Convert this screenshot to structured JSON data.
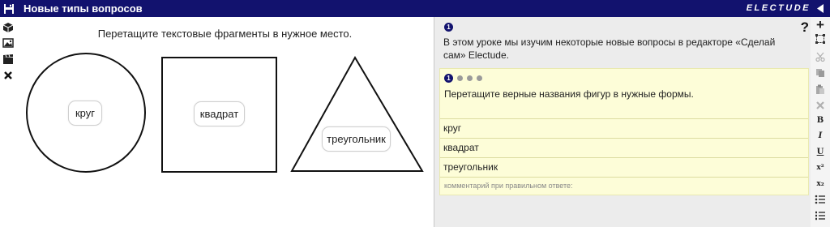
{
  "header": {
    "title": "Новые типы вопросов",
    "brand": "ELECTUDE",
    "save_icon": "floppy-disk-icon",
    "collapse_icon": "caret-left-icon"
  },
  "left_toolbar": {
    "icons": [
      "cube-icon",
      "image-icon",
      "video-clapper-icon",
      "close-icon"
    ]
  },
  "canvas": {
    "instruction": "Перетащите текстовые фрагменты в нужное место.",
    "labels": {
      "circle": "круг",
      "square": "квадрат",
      "triangle": "треугольник"
    }
  },
  "editor": {
    "intro_badge": "1",
    "help_label": "?",
    "intro_text": "В этом уроке мы изучим некоторые новые вопросы в редакторе «Сделай сам» Electude.",
    "question": {
      "badge": "1",
      "text": "Перетащите верные названия фигур в нужные формы.",
      "answers": [
        "круг",
        "квадрат",
        "треугольник"
      ],
      "comment_placeholder": "комментарий при правильном ответе:"
    }
  },
  "right_toolbar": {
    "add_label": "+",
    "bold_label": "B",
    "italic_label": "I",
    "underline_label": "U",
    "superscript_label": "x²",
    "subscript_label": "x₂",
    "icons": [
      "add-icon",
      "select-area-icon",
      "scissors-icon",
      "copy-icon",
      "paste-icon",
      "delete-icon",
      "bold-icon",
      "italic-icon",
      "underline-icon",
      "superscript-icon",
      "subscript-icon",
      "bulleted-list-icon",
      "numbered-list-icon"
    ]
  }
}
